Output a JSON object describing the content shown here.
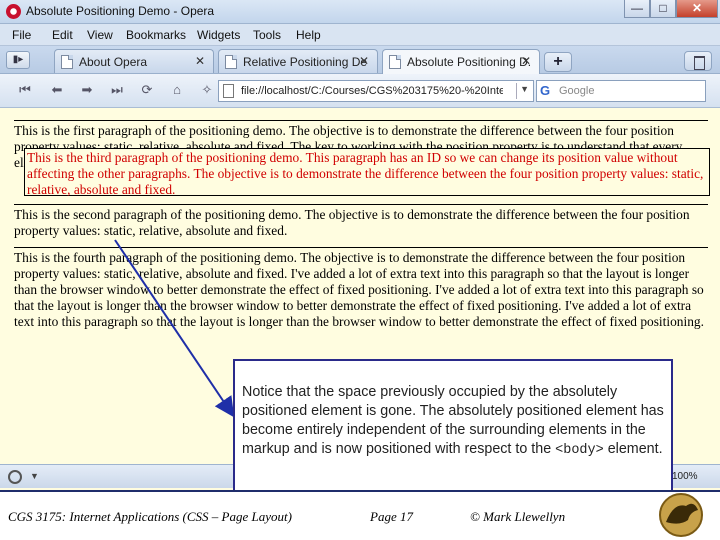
{
  "window": {
    "title": "Absolute Positioning Demo - Opera",
    "buttons": {
      "minimize": "—",
      "maximize": "□",
      "close": "✕"
    }
  },
  "menu": [
    "File",
    "Edit",
    "View",
    "Bookmarks",
    "Widgets",
    "Tools",
    "Help"
  ],
  "tabs": [
    {
      "label": "About Opera",
      "close": "✕",
      "active": false
    },
    {
      "label": "Relative Positioning De...",
      "close": "✕",
      "active": false
    },
    {
      "label": "Absolute Positioning D...",
      "close": "✕",
      "active": true
    }
  ],
  "new_tab": "+",
  "nav": {
    "buttons": [
      "rewind-icon",
      "back-icon",
      "forward-icon",
      "fast-forward-icon",
      "reload-icon",
      "home-icon",
      "wand-icon"
    ],
    "address": "file://localhost/C:/Courses/CGS%203175%20-%20Inte",
    "search_placeholder": "Google",
    "search_engine": "G"
  },
  "page": {
    "p1": "This is the first paragraph of the positioning demo. The objective is to demonstrate the difference between the four position property values: static, relative, absolute and fixed. The key to working with the position property is to understand that every element of",
    "p3": "This is the third paragraph of the positioning demo. This paragraph has an ID so we can change its position value without affecting the other paragraphs. The objective is to demonstrate the difference between the four position property values: static, relative, absolute and fixed.",
    "p2": "This is the second paragraph of the positioning demo. The objective is to demonstrate the difference between the four position property values: static, relative, absolute and fixed.",
    "p4": "This is the fourth paragraph of the positioning demo. The objective is to demonstrate the difference between the four position property values: static, relative, absolute and fixed. I've added a lot of extra text into this paragraph so that the layout is longer than the browser window to better demonstrate the effect of fixed positioning. I've added a lot of extra text into this paragraph so that the layout is longer than the browser window to better demonstrate the effect of fixed positioning. I've added a lot of extra text into this paragraph so that the layout is longer than the browser window to better demonstrate the effect of fixed positioning."
  },
  "status": {
    "zoom": "100%"
  },
  "callout": {
    "text_before": "Notice that the space previously occupied by the absolutely positioned element is gone.  The absolutely positioned element has become entirely independent of the surrounding elements in the markup and is now positioned with respect to the ",
    "code": "<body>",
    "text_after": "  element."
  },
  "footer": {
    "course": "CGS 3175: Internet Applications (CSS – Page Layout)",
    "page": "Page 17",
    "author": "© Mark Llewellyn"
  },
  "colors": {
    "accent_red": "#d00000",
    "callout_border": "#2a2a8a",
    "page_bg": "#fffde0"
  }
}
